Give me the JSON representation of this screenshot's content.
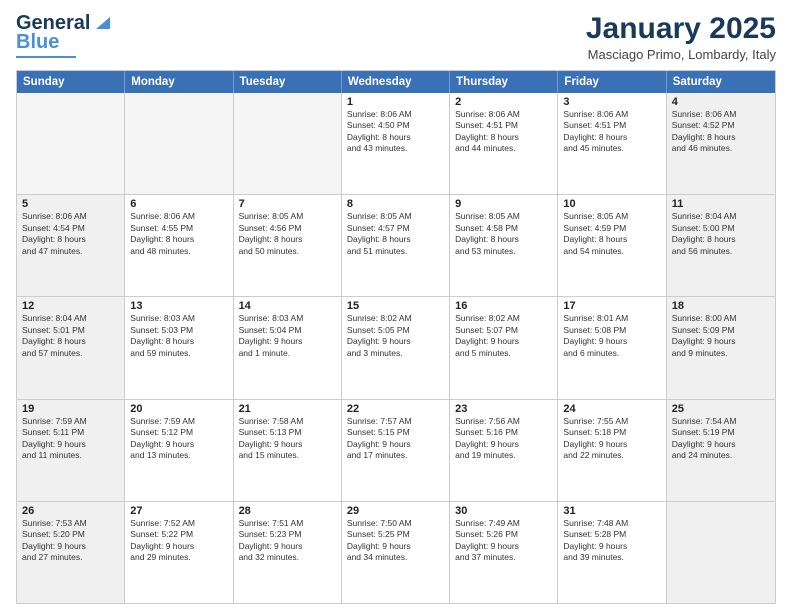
{
  "logo": {
    "line1": "General",
    "line2": "Blue"
  },
  "title": "January 2025",
  "location": "Masciago Primo, Lombardy, Italy",
  "header_days": [
    "Sunday",
    "Monday",
    "Tuesday",
    "Wednesday",
    "Thursday",
    "Friday",
    "Saturday"
  ],
  "rows": [
    [
      {
        "day": "",
        "text": "",
        "empty": true
      },
      {
        "day": "",
        "text": "",
        "empty": true
      },
      {
        "day": "",
        "text": "",
        "empty": true
      },
      {
        "day": "1",
        "text": "Sunrise: 8:06 AM\nSunset: 4:50 PM\nDaylight: 8 hours\nand 43 minutes."
      },
      {
        "day": "2",
        "text": "Sunrise: 8:06 AM\nSunset: 4:51 PM\nDaylight: 8 hours\nand 44 minutes."
      },
      {
        "day": "3",
        "text": "Sunrise: 8:06 AM\nSunset: 4:51 PM\nDaylight: 8 hours\nand 45 minutes."
      },
      {
        "day": "4",
        "text": "Sunrise: 8:06 AM\nSunset: 4:52 PM\nDaylight: 8 hours\nand 46 minutes.",
        "shaded": true
      }
    ],
    [
      {
        "day": "5",
        "text": "Sunrise: 8:06 AM\nSunset: 4:54 PM\nDaylight: 8 hours\nand 47 minutes.",
        "shaded": true
      },
      {
        "day": "6",
        "text": "Sunrise: 8:06 AM\nSunset: 4:55 PM\nDaylight: 8 hours\nand 48 minutes."
      },
      {
        "day": "7",
        "text": "Sunrise: 8:05 AM\nSunset: 4:56 PM\nDaylight: 8 hours\nand 50 minutes."
      },
      {
        "day": "8",
        "text": "Sunrise: 8:05 AM\nSunset: 4:57 PM\nDaylight: 8 hours\nand 51 minutes."
      },
      {
        "day": "9",
        "text": "Sunrise: 8:05 AM\nSunset: 4:58 PM\nDaylight: 8 hours\nand 53 minutes."
      },
      {
        "day": "10",
        "text": "Sunrise: 8:05 AM\nSunset: 4:59 PM\nDaylight: 8 hours\nand 54 minutes."
      },
      {
        "day": "11",
        "text": "Sunrise: 8:04 AM\nSunset: 5:00 PM\nDaylight: 8 hours\nand 56 minutes.",
        "shaded": true
      }
    ],
    [
      {
        "day": "12",
        "text": "Sunrise: 8:04 AM\nSunset: 5:01 PM\nDaylight: 8 hours\nand 57 minutes.",
        "shaded": true
      },
      {
        "day": "13",
        "text": "Sunrise: 8:03 AM\nSunset: 5:03 PM\nDaylight: 8 hours\nand 59 minutes."
      },
      {
        "day": "14",
        "text": "Sunrise: 8:03 AM\nSunset: 5:04 PM\nDaylight: 9 hours\nand 1 minute."
      },
      {
        "day": "15",
        "text": "Sunrise: 8:02 AM\nSunset: 5:05 PM\nDaylight: 9 hours\nand 3 minutes."
      },
      {
        "day": "16",
        "text": "Sunrise: 8:02 AM\nSunset: 5:07 PM\nDaylight: 9 hours\nand 5 minutes."
      },
      {
        "day": "17",
        "text": "Sunrise: 8:01 AM\nSunset: 5:08 PM\nDaylight: 9 hours\nand 6 minutes."
      },
      {
        "day": "18",
        "text": "Sunrise: 8:00 AM\nSunset: 5:09 PM\nDaylight: 9 hours\nand 9 minutes.",
        "shaded": true
      }
    ],
    [
      {
        "day": "19",
        "text": "Sunrise: 7:59 AM\nSunset: 5:11 PM\nDaylight: 9 hours\nand 11 minutes.",
        "shaded": true
      },
      {
        "day": "20",
        "text": "Sunrise: 7:59 AM\nSunset: 5:12 PM\nDaylight: 9 hours\nand 13 minutes."
      },
      {
        "day": "21",
        "text": "Sunrise: 7:58 AM\nSunset: 5:13 PM\nDaylight: 9 hours\nand 15 minutes."
      },
      {
        "day": "22",
        "text": "Sunrise: 7:57 AM\nSunset: 5:15 PM\nDaylight: 9 hours\nand 17 minutes."
      },
      {
        "day": "23",
        "text": "Sunrise: 7:56 AM\nSunset: 5:16 PM\nDaylight: 9 hours\nand 19 minutes."
      },
      {
        "day": "24",
        "text": "Sunrise: 7:55 AM\nSunset: 5:18 PM\nDaylight: 9 hours\nand 22 minutes."
      },
      {
        "day": "25",
        "text": "Sunrise: 7:54 AM\nSunset: 5:19 PM\nDaylight: 9 hours\nand 24 minutes.",
        "shaded": true
      }
    ],
    [
      {
        "day": "26",
        "text": "Sunrise: 7:53 AM\nSunset: 5:20 PM\nDaylight: 9 hours\nand 27 minutes.",
        "shaded": true
      },
      {
        "day": "27",
        "text": "Sunrise: 7:52 AM\nSunset: 5:22 PM\nDaylight: 9 hours\nand 29 minutes."
      },
      {
        "day": "28",
        "text": "Sunrise: 7:51 AM\nSunset: 5:23 PM\nDaylight: 9 hours\nand 32 minutes."
      },
      {
        "day": "29",
        "text": "Sunrise: 7:50 AM\nSunset: 5:25 PM\nDaylight: 9 hours\nand 34 minutes."
      },
      {
        "day": "30",
        "text": "Sunrise: 7:49 AM\nSunset: 5:26 PM\nDaylight: 9 hours\nand 37 minutes."
      },
      {
        "day": "31",
        "text": "Sunrise: 7:48 AM\nSunset: 5:28 PM\nDaylight: 9 hours\nand 39 minutes."
      },
      {
        "day": "",
        "text": "",
        "empty": true,
        "shaded": true
      }
    ]
  ]
}
